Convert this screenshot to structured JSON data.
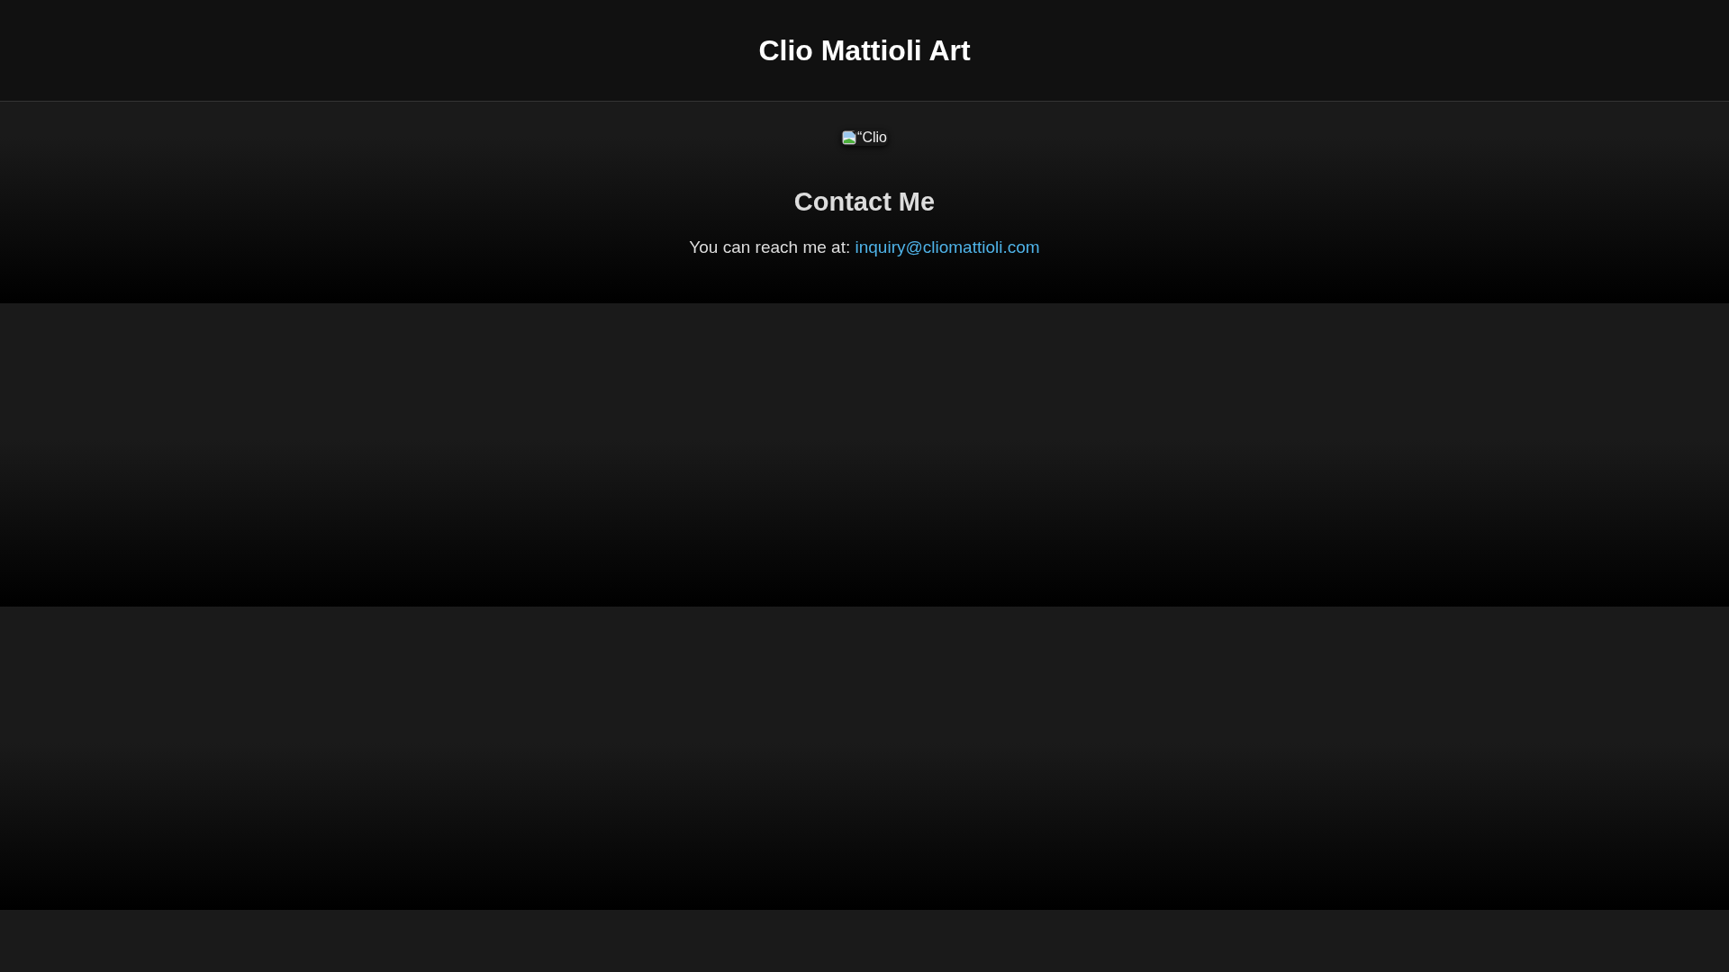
{
  "header": {
    "title": "Clio Mattioli Art"
  },
  "profile_image": {
    "alt_text": "“Clio"
  },
  "contact": {
    "heading": "Contact Me",
    "text": "You can reach me at:",
    "email": "inquiry@cliomattioli.com"
  }
}
